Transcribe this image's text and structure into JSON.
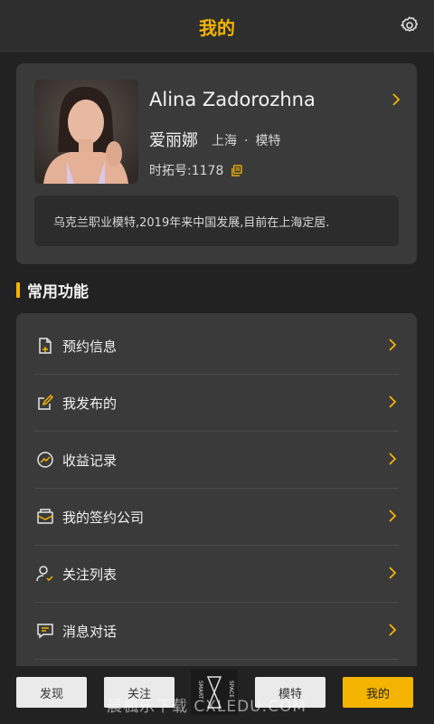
{
  "header": {
    "title": "我的",
    "settings_icon": "gear-icon"
  },
  "profile": {
    "name_en": "Alina Zadorozhna",
    "name_cn": "爱丽娜",
    "city": "上海",
    "separator": "·",
    "role": "模特",
    "tuo_id": "时拓号:1178",
    "bio": "乌克兰职业模特,2019年来中国发展,目前在上海定居."
  },
  "section": {
    "title": "常用功能"
  },
  "functions": [
    {
      "label": "预约信息",
      "icon": "booking-icon"
    },
    {
      "label": "我发布的",
      "icon": "edit-icon"
    },
    {
      "label": "收益记录",
      "icon": "earnings-icon"
    },
    {
      "label": "我的签约公司",
      "icon": "company-icon"
    },
    {
      "label": "关注列表",
      "icon": "follow-icon"
    },
    {
      "label": "消息对话",
      "icon": "message-icon"
    }
  ],
  "bottom_nav": {
    "discover": "发现",
    "follow": "关注",
    "model": "模特",
    "mine": "我的",
    "logo_left": "SMART",
    "logo_right": "SPACE"
  },
  "watermark": "晨楓乐下载 CXLEDU.COM",
  "colors": {
    "accent": "#f5b400",
    "background": "#222222",
    "card": "#3a3a3a"
  }
}
